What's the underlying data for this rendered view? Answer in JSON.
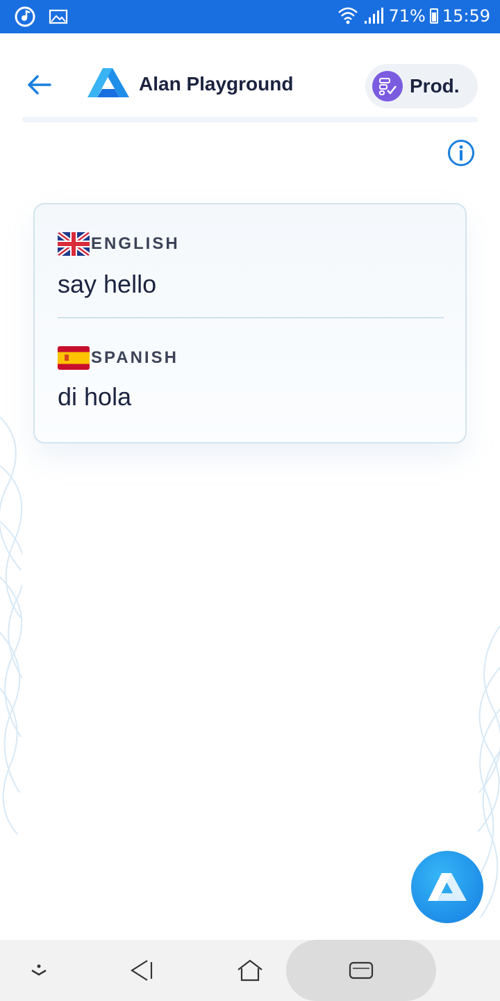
{
  "status_bar": {
    "battery": "71%",
    "time": "15:59",
    "icons": [
      "music-app-icon",
      "gallery-icon",
      "wifi-icon",
      "signal-icon",
      "battery-icon"
    ]
  },
  "header": {
    "title": "Alan Playground",
    "environment": "Prod.",
    "icons": [
      "back-arrow-icon",
      "alan-logo-icon",
      "environment-icon",
      "info-icon"
    ]
  },
  "translation": {
    "source": {
      "language": "ENGLISH",
      "flag": "uk-flag-icon",
      "text": "say hello"
    },
    "target": {
      "language": "SPANISH",
      "flag": "spain-flag-icon",
      "text": "di hola"
    }
  },
  "navigation_bar": {
    "icons": [
      "hide-keyboard-icon",
      "back-icon",
      "home-icon",
      "recents-icon"
    ]
  },
  "colors": {
    "status_bar": "#1a6fe0",
    "accent": "#1a7fde",
    "title_text": "#1c2340",
    "card_border": "#d3e4ef",
    "env_badge": "#7b5ce0"
  }
}
